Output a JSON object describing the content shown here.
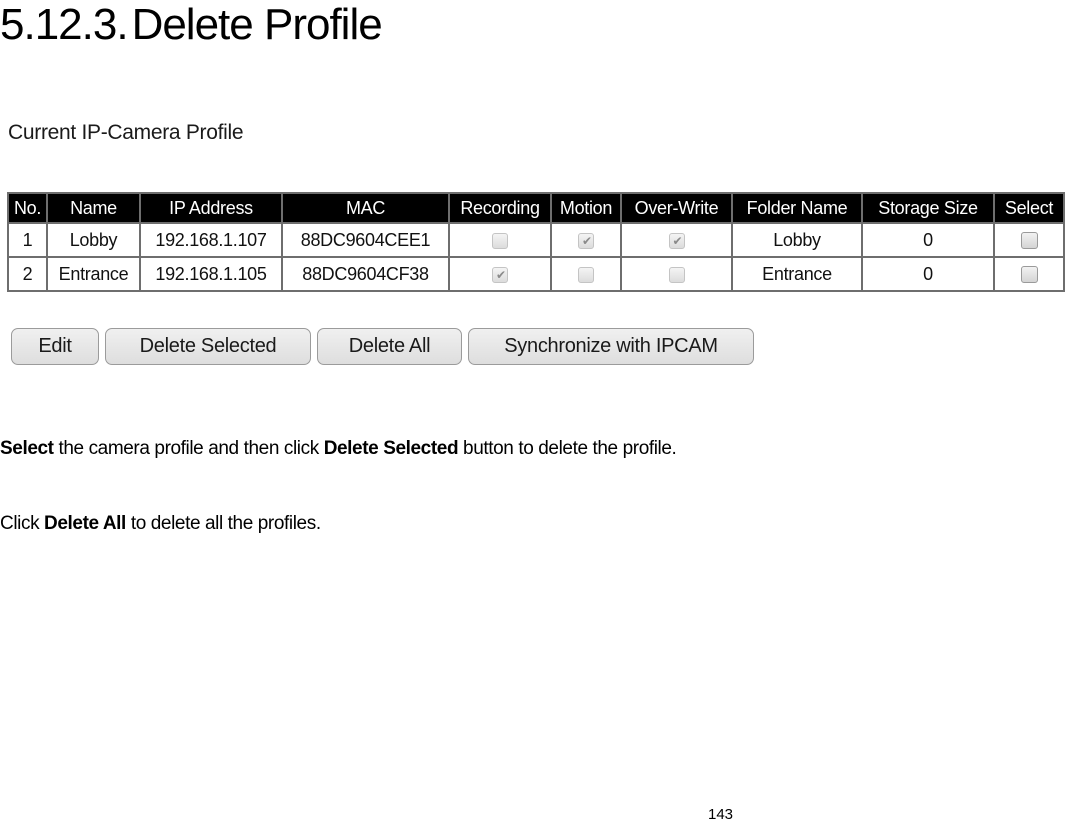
{
  "heading": {
    "number": "5.12.3.",
    "title": "Delete Profile"
  },
  "section_title": "Current IP-Camera Profile",
  "table": {
    "columns": [
      "No.",
      "Name",
      "IP Address",
      "MAC",
      "Recording",
      "Motion",
      "Over-Write",
      "Folder Name",
      "Storage Size",
      "Select"
    ],
    "rows": [
      {
        "no": "1",
        "name": "Lobby",
        "ip": "192.168.1.107",
        "mac": "88DC9604CEE1",
        "recording": false,
        "motion": true,
        "overwrite": true,
        "folder": "Lobby",
        "storage": "0",
        "select": false
      },
      {
        "no": "2",
        "name": "Entrance",
        "ip": "192.168.1.105",
        "mac": "88DC9604CF38",
        "recording": true,
        "motion": false,
        "overwrite": false,
        "folder": "Entrance",
        "storage": "0",
        "select": false
      }
    ]
  },
  "buttons": {
    "edit": "Edit",
    "delete_selected": "Delete Selected",
    "delete_all": "Delete All",
    "sync": "Synchronize with IPCAM"
  },
  "instructions": {
    "p1": {
      "bold1": "Select",
      "text1": " the camera profile and then click ",
      "bold2": "Delete Selected",
      "text2": " button to delete the profile."
    },
    "p2": {
      "text1": "Click ",
      "bold1": "Delete All",
      "text2": " to delete all the profiles."
    }
  },
  "page_number": "143",
  "icons": {
    "check": "✔"
  }
}
